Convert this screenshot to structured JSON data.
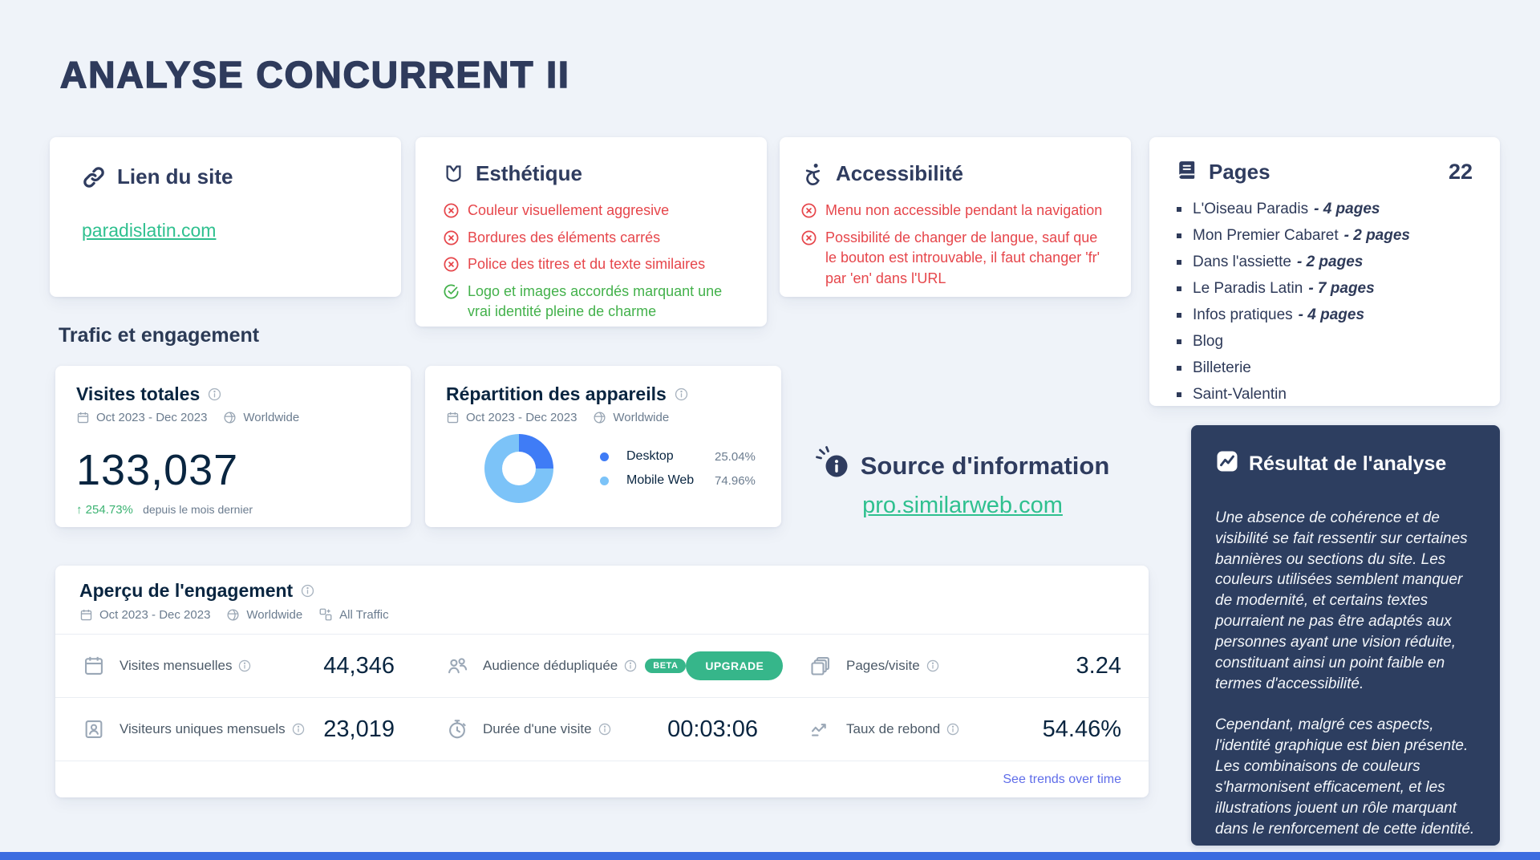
{
  "title": "ANALYSE CONCURRENT II",
  "colors": {
    "fail_red": "#e6464b",
    "pass_green": "#43b14b",
    "link_green": "#2fc08f",
    "navy": "#2f3c5f",
    "upgrade_green": "#36b68a",
    "trend_link_blue": "#5f6de9",
    "result_card_bg": "#2d3e60",
    "bottom_bar_blue": "#3b6ce0"
  },
  "site_link_card": {
    "title": "Lien du site",
    "link": "paradislatin.com"
  },
  "esthetique_card": {
    "title": "Esthétique",
    "items": [
      {
        "status": "fail",
        "text": "Couleur visuellement aggresive"
      },
      {
        "status": "fail",
        "text": "Bordures des éléments carrés"
      },
      {
        "status": "fail",
        "text": "Police des titres et du texte similaires"
      },
      {
        "status": "pass",
        "text": "Logo et images accordés marquant une vrai identité pleine de charme"
      }
    ]
  },
  "accessibilite_card": {
    "title": "Accessibilité",
    "items": [
      {
        "status": "fail",
        "text": "Menu non accessible pendant la navigation"
      },
      {
        "status": "fail",
        "text": "Possibilité de changer de langue, sauf que le bouton est introuvable, il faut changer 'fr' par 'en' dans l'URL"
      }
    ]
  },
  "pages_card": {
    "title": "Pages",
    "count": "22",
    "items": [
      {
        "name": "L'Oiseau Paradis",
        "detail": "- 4 pages"
      },
      {
        "name": "Mon Premier Cabaret",
        "detail": "- 2 pages"
      },
      {
        "name": "Dans l'assiette",
        "detail": "- 2 pages"
      },
      {
        "name": "Le Paradis Latin",
        "detail": "- 7 pages"
      },
      {
        "name": "Infos pratiques",
        "detail": "- 4 pages"
      },
      {
        "name": "Blog",
        "detail": ""
      },
      {
        "name": "Billeterie",
        "detail": ""
      },
      {
        "name": "Saint-Valentin",
        "detail": ""
      }
    ]
  },
  "traffic_section": {
    "heading": "Trafic et engagement",
    "total_visits": {
      "title": "Visites totales",
      "date_range": "Oct 2023 - Dec 2023",
      "region": "Worldwide",
      "value": "133,037",
      "change": "↑ 254.73%",
      "change_caption": "depuis le mois dernier"
    },
    "devices": {
      "title": "Répartition des appareils",
      "date_range": "Oct 2023 - Dec 2023",
      "region": "Worldwide"
    }
  },
  "chart_data": {
    "type": "pie",
    "variant": "donut",
    "title": "Répartition des appareils",
    "labels": [
      "Desktop",
      "Mobile Web"
    ],
    "values": [
      25.04,
      74.96
    ],
    "value_labels": [
      "25.04%",
      "74.96%"
    ],
    "colors": [
      "#3f7cf6",
      "#7cc3f8"
    ],
    "legend_position": "right"
  },
  "source": {
    "title": "Source d'information",
    "link": "pro.similarweb.com"
  },
  "engagement_card": {
    "title": "Aperçu de l'engagement",
    "date_range": "Oct 2023 - Dec 2023",
    "region": "Worldwide",
    "traffic_filter": "All Traffic",
    "metrics": [
      {
        "label": "Visites mensuelles",
        "value": "44,346"
      },
      {
        "label": "Audience dédupliquée",
        "badge": "BETA",
        "button": "UPGRADE"
      },
      {
        "label": "Pages/visite",
        "value": "3.24"
      },
      {
        "label": "Visiteurs uniques mensuels",
        "value": "23,019"
      },
      {
        "label": "Durée d'une visite",
        "value": "00:03:06"
      },
      {
        "label": "Taux de rebond",
        "value": "54.46%"
      }
    ],
    "footer_link": "See trends over time"
  },
  "result_card": {
    "title": "Résultat de l'analyse",
    "paragraphs": [
      "Une absence de cohérence et de visibilité se fait ressentir sur certaines bannières ou sections du site. Les couleurs utilisées semblent manquer de modernité, et certains textes pourraient ne pas être adaptés aux personnes ayant une vision réduite, constituant ainsi un point faible en termes d'accessibilité.",
      "Cependant, malgré ces aspects, l'identité graphique est bien présente. Les combinaisons de couleurs s'harmonisent efficacement, et les illustrations jouent un rôle marquant dans le renforcement de cette identité."
    ]
  }
}
